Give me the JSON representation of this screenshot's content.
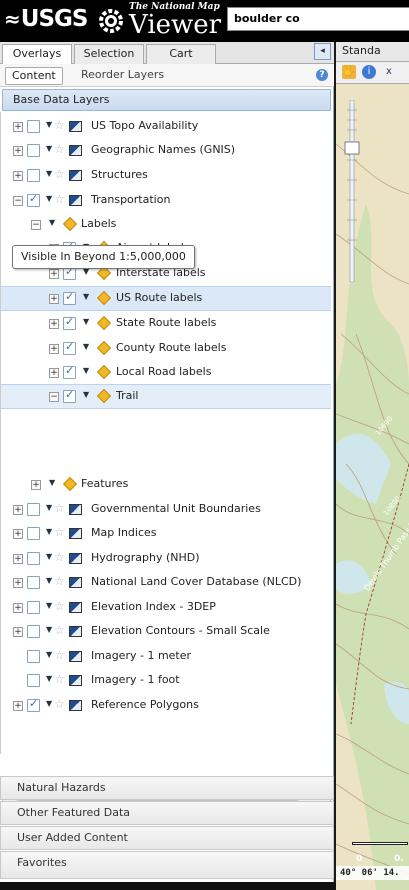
{
  "header": {
    "usgs_label": "USGS",
    "tnm_label": "The National Map",
    "viewer_label": "Viewer",
    "search_value": "boulder co"
  },
  "tabs": [
    {
      "label": "Overlays",
      "active": true
    },
    {
      "label": "Selection",
      "active": false
    },
    {
      "label": "Cart",
      "active": false
    }
  ],
  "collapse_icon": "◂",
  "subtabs": {
    "content": "Content",
    "reorder": "Reorder Layers",
    "help": "?"
  },
  "base_data_layers_title": "Base Data Layers",
  "tree": {
    "us_topo": "US Topo Availability",
    "gnis": "Geographic Names (GNIS)",
    "structures": "Structures",
    "transportation": "Transportation",
    "labels": "Labels",
    "airport_labels": "Airport labels",
    "interstate": "Interstate labels",
    "us_route": "US Route labels",
    "state_route": "State Route labels",
    "county_route": "County Route labels",
    "local_road": "Local Road labels",
    "trail": "Trail",
    "features": "Features",
    "gov_units": "Governmental Unit Boundaries",
    "map_indices": "Map Indices",
    "hydrography": "Hydrography (NHD)",
    "nlcd": "National Land Cover Database (NLCD)",
    "elev_index": "Elevation Index - 3DEP",
    "elev_contours": "Elevation Contours - Small Scale",
    "imagery_1m": "Imagery - 1 meter",
    "imagery_1ft": "Imagery - 1 foot",
    "reference_polygons": "Reference Polygons"
  },
  "tooltip": "Visible In Beyond 1:5,000,000",
  "accordions": {
    "natural_hazards": "Natural Hazards",
    "other_featured": "Other Featured Data",
    "user_added": "User Added Content",
    "favorites": "Favorites"
  },
  "map": {
    "tab_label": "Standa",
    "coords": "40° 06' 14.",
    "scale_0": "0",
    "scale_1": "0.",
    "contour_label_1": "10600",
    "contour_label_2": "10800",
    "place_label": "Devils Thumb Pass Trail"
  },
  "colors": {
    "panel_header": "#c9daf0",
    "selected_row": "#dbe8f7",
    "map_background": "#ece3c4",
    "water": "#cfe6ea",
    "vegetation": "#cfe0b4",
    "contour": "#b58f6a"
  }
}
